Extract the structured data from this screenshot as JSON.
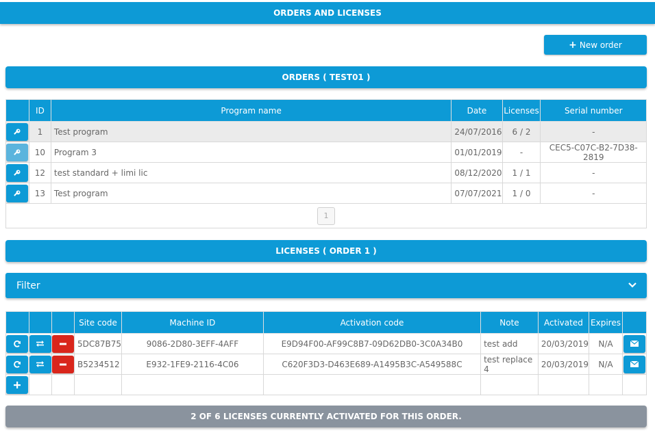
{
  "header": {
    "title": "ORDERS AND LICENSES"
  },
  "toolbar": {
    "new_order_label": "New order"
  },
  "orders_section": {
    "title": "ORDERS ( TEST01 )",
    "columns": [
      "ID",
      "Program name",
      "Date",
      "Licenses",
      "Serial number"
    ],
    "rows": [
      {
        "id": "1",
        "program": "Test program",
        "date": "24/07/2016",
        "licenses": "6 / 2",
        "serial": "-"
      },
      {
        "id": "10",
        "program": "Program 3",
        "date": "01/01/2019",
        "licenses": "-",
        "serial": "CEC5-C07C-B2-7D38-2819"
      },
      {
        "id": "12",
        "program": "test standard + limi lic",
        "date": "08/12/2020",
        "licenses": "1 / 1",
        "serial": "-"
      },
      {
        "id": "13",
        "program": "Test program",
        "date": "07/07/2021",
        "licenses": "1 / 0",
        "serial": "-"
      }
    ],
    "pager": {
      "current_page": "1"
    }
  },
  "licenses_section": {
    "title": "LICENSES ( ORDER 1 )",
    "filter_label": "Filter",
    "columns": [
      "Site code",
      "Machine ID",
      "Activation code",
      "Note",
      "Activated",
      "Expires"
    ],
    "rows": [
      {
        "site": "5DC87B75",
        "machine": "9086-2D80-3EFF-4AFF",
        "activation": "E9D94F00-AF99C8B7-09D62DB0-3C0A34B0",
        "note": "test add",
        "activated": "20/03/2019",
        "expires": "N/A"
      },
      {
        "site": "B5234512",
        "machine": "E932-1FE9-2116-4C06",
        "activation": "C620F3D3-D463E689-A1495B3C-A549588C",
        "note": "test replace 4",
        "activated": "20/03/2019",
        "expires": "N/A"
      }
    ]
  },
  "status": {
    "text": "2 OF 6 LICENSES CURRENTLY ACTIVATED FOR THIS ORDER."
  },
  "colors": {
    "accent": "#0d9ad6",
    "danger": "#d9261c",
    "status_bg": "#8a939e"
  },
  "icons": {
    "key": "key-icon",
    "refresh": "refresh-icon",
    "swap": "swap-icon",
    "remove": "minus-icon",
    "mail": "envelope-icon",
    "add": "plus-icon",
    "chevron": "chevron-down-icon"
  }
}
